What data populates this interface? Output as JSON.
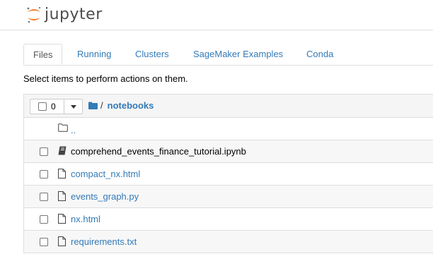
{
  "header": {
    "logo_text": "jupyter"
  },
  "tabs": [
    {
      "label": "Files",
      "active": true
    },
    {
      "label": "Running",
      "active": false
    },
    {
      "label": "Clusters",
      "active": false
    },
    {
      "label": "SageMaker Examples",
      "active": false
    },
    {
      "label": "Conda",
      "active": false
    }
  ],
  "hint": "Select items to perform actions on them.",
  "toolbar": {
    "selected_count": "0",
    "path_separator": "/",
    "current_folder": "notebooks"
  },
  "parent_dir": "..",
  "files": [
    {
      "name": "comprehend_events_finance_tutorial.ipynb",
      "icon": "notebook-icon"
    },
    {
      "name": "compact_nx.html",
      "icon": "file-icon"
    },
    {
      "name": "events_graph.py",
      "icon": "file-icon"
    },
    {
      "name": "nx.html",
      "icon": "file-icon"
    },
    {
      "name": "requirements.txt",
      "icon": "file-icon"
    }
  ],
  "colors": {
    "link": "#337ab7",
    "logo_orange": "#f37726",
    "logo_text": "#4d4d4d"
  }
}
